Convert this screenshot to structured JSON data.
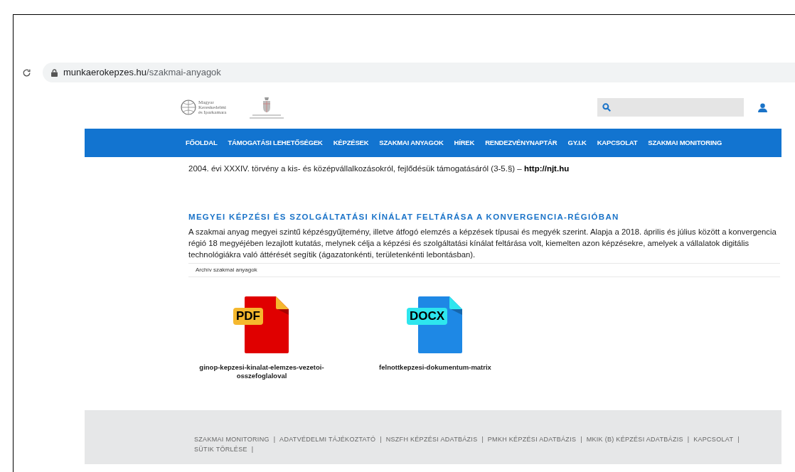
{
  "browser": {
    "url_host": "munkaerokepzes.hu",
    "url_path": "/szakmai-anyagok"
  },
  "header": {
    "logo_lines": [
      "Magyar",
      "Kereskedelmi",
      "és Iparkamara"
    ]
  },
  "nav": {
    "items": [
      {
        "label": "FŐOLDAL",
        "selected": false
      },
      {
        "label": "TÁMOGATÁSI LEHETŐSÉGEK",
        "selected": false
      },
      {
        "label": "KÉPZÉSEK",
        "selected": false
      },
      {
        "label": "SZAKMAI ANYAGOK",
        "selected": false
      },
      {
        "label": "HÍREK",
        "selected": false
      },
      {
        "label": "RENDEZVÉNYNAPTÁR",
        "selected": false
      },
      {
        "label": "GY.I.K",
        "selected": false
      },
      {
        "label": "KAPCSOLAT",
        "selected": false
      },
      {
        "label": "SZAKMAI MONITORING",
        "selected": false
      }
    ]
  },
  "content": {
    "law_line": {
      "text": "2004. évi XXXIV. törvény a kis- és középvállalkozásokról, fejlődésük támogatásáról (3-5.§) –",
      "link": "http://njt.hu"
    },
    "heading": "MEGYEI KÉPZÉSI ÉS SZOLGÁLTATÁSI KÍNÁLAT FELTÁRÁSA A KONVERGENCIA-RÉGIÓBAN",
    "paragraph": "A szakmai anyag megyei szintű képzésgyűjtemény, illetve átfogó elemzés a képzések típusai és megyék szerint. Alapja a 2018. április és július között a konvergencia régió 18 megyéjében lezajlott kutatás, melynek célja a képzési és szolgáltatási kínálat feltárása volt, kiemelten azon képzésekre, amelyek a vállalatok digitális technológiákra való áttérését segítik (ágazatonkénti, területenkénti lebontásban).",
    "archive_bar": "Archív szakmai anyagok",
    "files": [
      {
        "kind": "pdf",
        "badge": "PDF",
        "name": "ginop-kepzesi-kinalat-elemzes-vezetoi-osszefoglaloval"
      },
      {
        "kind": "docx",
        "badge": "DOCX",
        "name": "felnottkepzesi-dokumentum-matrix"
      }
    ]
  },
  "footer": {
    "separator": "|",
    "links": [
      "SZAKMAI MONITORING",
      "ADATVÉDELMI TÁJÉKOZTATÓ",
      "NSZFH KÉPZÉSI ADATBÁZIS",
      "PMKH KÉPZÉSI ADATBÁZIS",
      "MKIK (B) KÉPZÉSI ADATBÁZIS",
      "KAPCSOLAT",
      "SÜTIK TÖRLÉSE"
    ]
  }
}
